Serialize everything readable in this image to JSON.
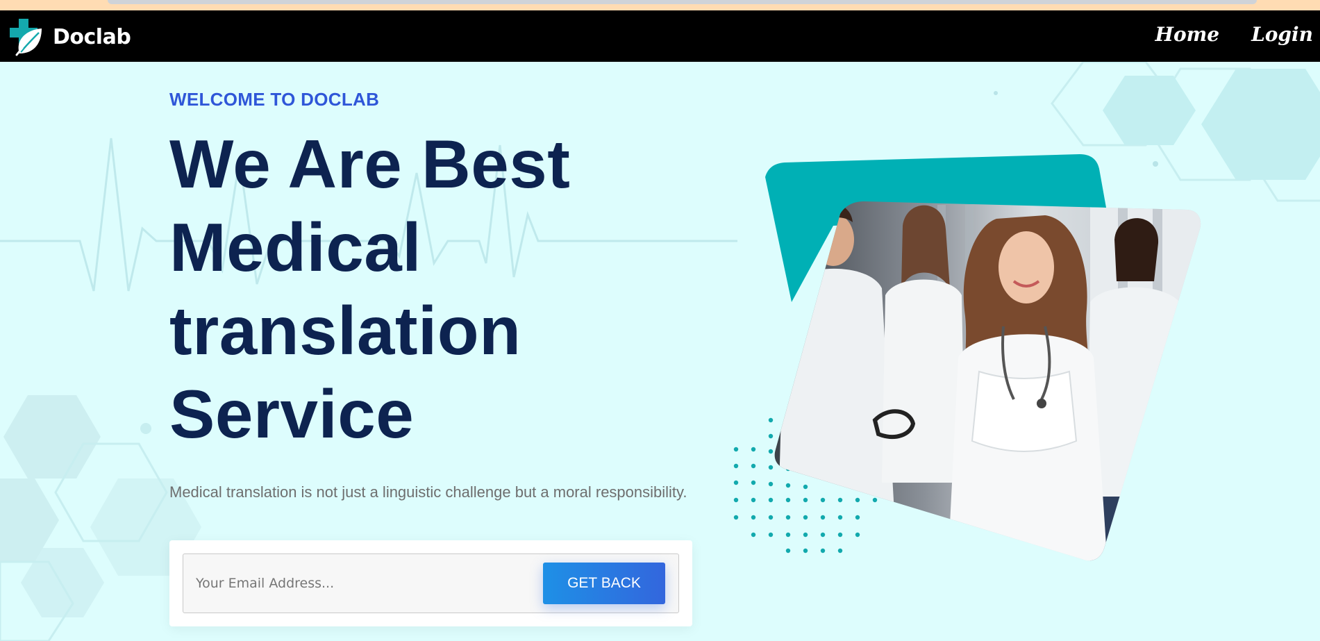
{
  "brand": {
    "name": "Doclab"
  },
  "nav": {
    "items": [
      {
        "label": "Home"
      },
      {
        "label": "Login"
      }
    ]
  },
  "hero": {
    "eyebrow": "WELCOME TO DOCLAB",
    "headline": [
      "We Are Best",
      "Medical",
      "translation",
      "Service"
    ],
    "subtext": "Medical translation is not just a linguistic challenge but a moral responsibility."
  },
  "form": {
    "email_placeholder": "Your Email Address...",
    "email_value": "",
    "submit_label": "GET BACK"
  },
  "colors": {
    "background": "#ddfdfd",
    "navbar": "#000000",
    "accent_blue": "#2f56d8",
    "heading_navy": "#0d2350",
    "teal": "#00b0b5",
    "button_start": "#1e90e6",
    "button_end": "#3366dd"
  },
  "icons": {
    "brand": "medical-cross-leaf-icon"
  },
  "images": {
    "hero": "smiling-doctor-with-team-photo"
  }
}
